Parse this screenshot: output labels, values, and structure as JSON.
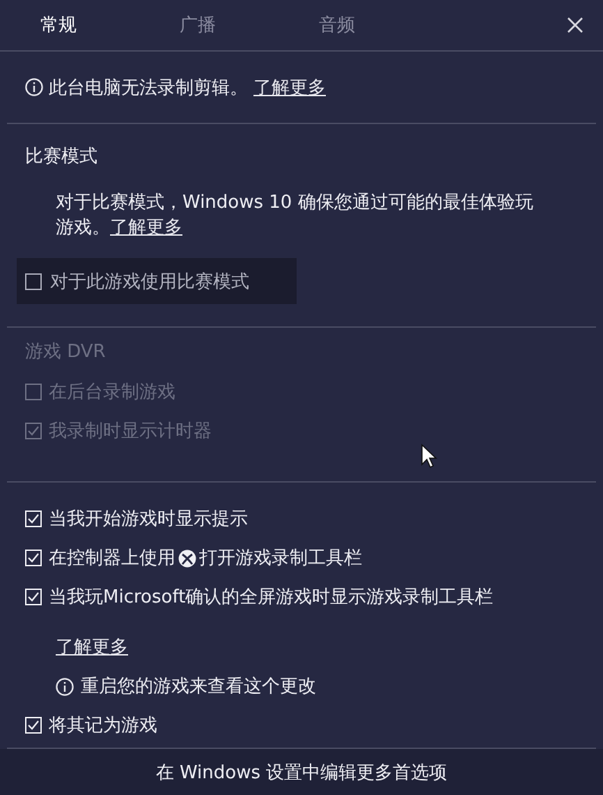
{
  "tabs": [
    {
      "label": "常规",
      "selected": true
    },
    {
      "label": "广播",
      "selected": false
    },
    {
      "label": "音频",
      "selected": false
    }
  ],
  "notice": {
    "text": "此台电脑无法录制剪辑。",
    "link": "了解更多"
  },
  "game_mode": {
    "title": "比赛模式",
    "description": "对于比赛模式，Windows 10 确保您通过可能的最佳体验玩游戏。",
    "link": "了解更多",
    "option": {
      "label": "对于此游戏使用比赛模式",
      "checked": false
    }
  },
  "game_dvr": {
    "title": "游戏 DVR",
    "disabled": true,
    "options": [
      {
        "label": "在后台录制游戏",
        "checked": false
      },
      {
        "label": "我录制时显示计时器",
        "checked": true
      }
    ]
  },
  "options": [
    {
      "kind": "text",
      "label": "当我开始游戏时显示提示",
      "checked": true
    },
    {
      "kind": "icon_text",
      "label": "在控制器上使用",
      "label_after": "打开游戏录制工具栏",
      "checked": true
    },
    {
      "kind": "text",
      "label": "当我玩Microsoft确认的全屏游戏时显示游戏录制工具栏",
      "checked": true
    }
  ],
  "learn_more": "了解更多",
  "restart_note": "重启您的游戏来查看这个更改",
  "mark_as_game": {
    "label": "将其记为游戏",
    "checked": true
  },
  "footer": "在 Windows 设置中编辑更多首选项"
}
